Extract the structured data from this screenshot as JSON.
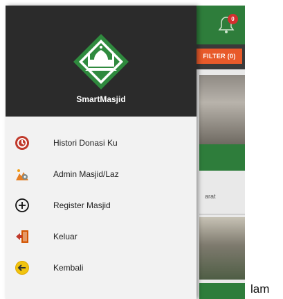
{
  "app": {
    "filter_label": "FILTER (0)",
    "notification_count": "0",
    "card_text": "arat"
  },
  "drawer": {
    "app_name": "SmartMasjid",
    "menu": [
      {
        "label": "Histori Donasi Ku",
        "icon": "history-donation-icon"
      },
      {
        "label": "Admin Masjid/Laz",
        "icon": "admin-icon"
      },
      {
        "label": "Register Masjid",
        "icon": "plus-circle-icon"
      },
      {
        "label": "Keluar",
        "icon": "logout-door-icon"
      },
      {
        "label": "Kembali",
        "icon": "back-arrow-icon"
      }
    ]
  },
  "outside_text": "lam",
  "colors": {
    "header_green": "#2e7d3b",
    "drawer_header": "#2b2b2b",
    "filter_orange": "#e85a2a",
    "badge_red": "#d32f2f"
  }
}
